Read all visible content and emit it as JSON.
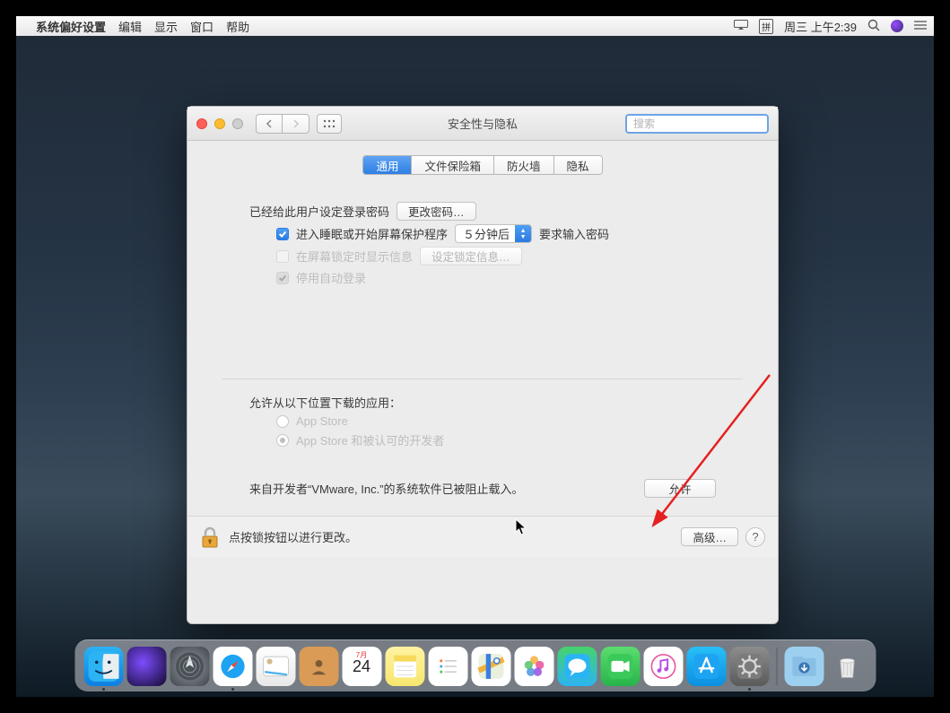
{
  "menubar": {
    "app_name": "系统偏好设置",
    "items": [
      "编辑",
      "显示",
      "窗口",
      "帮助"
    ],
    "clock": "周三 上午2:39"
  },
  "window": {
    "title": "安全性与隐私",
    "search_placeholder": "搜索",
    "tabs": [
      "通用",
      "文件保险箱",
      "防火墙",
      "隐私"
    ],
    "login_password_set_label": "已经给此用户设定登录密码",
    "change_password_btn": "更改密码…",
    "require_pw_checkbox": "进入睡眠或开始屏幕保护程序",
    "require_pw_delay": "５分钟后",
    "require_pw_suffix": "要求输入密码",
    "show_msg_checkbox": "在屏幕锁定时显示信息",
    "set_lock_msg_btn": "设定锁定信息…",
    "disable_autologin": "停用自动登录",
    "allow_apps_heading": "允许从以下位置下载的应用：",
    "radio_appstore": "App Store",
    "radio_identified": "App Store 和被认可的开发者",
    "blocked_msg": "来自开发者“VMware, Inc.”的系统软件已被阻止载入。",
    "allow_btn": "允许",
    "lock_text": "点按锁按钮以进行更改。",
    "advanced_btn": "高级…",
    "help": "?"
  },
  "calendar": {
    "month": "7月",
    "day": "24"
  },
  "dock": {
    "items": [
      "finder",
      "siri",
      "launchpad",
      "safari",
      "mail",
      "contacts",
      "calendar",
      "notes",
      "reminders",
      "maps",
      "photos",
      "messages",
      "facetime",
      "itunes",
      "appstore",
      "sysprefs"
    ],
    "extras": [
      "downloads",
      "trash"
    ]
  }
}
